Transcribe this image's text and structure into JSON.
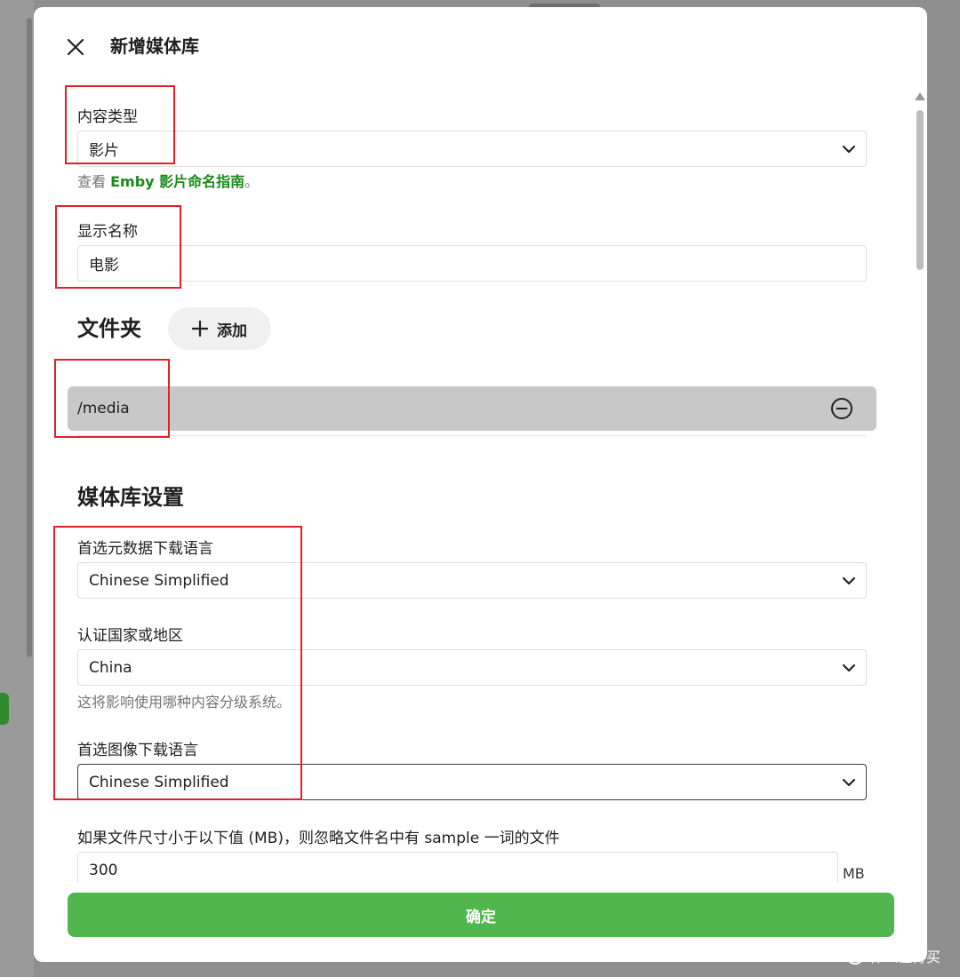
{
  "dialog": {
    "title": "新增媒体库",
    "confirm_label": "确定"
  },
  "content_type": {
    "label": "内容类型",
    "value": "影片",
    "hint_prefix": "查看 ",
    "hint_link": "Emby 影片命名指南",
    "hint_suffix": "。"
  },
  "display_name": {
    "label": "显示名称",
    "value": "电影"
  },
  "folders": {
    "title": "文件夹",
    "add_label": "添加",
    "items": [
      {
        "path": "/media"
      }
    ]
  },
  "library_settings": {
    "title": "媒体库设置",
    "metadata_language": {
      "label": "首选元数据下载语言",
      "value": "Chinese Simplified"
    },
    "country": {
      "label": "认证国家或地区",
      "value": "China",
      "hint": "这将影响使用哪种内容分级系统。"
    },
    "image_language": {
      "label": "首选图像下载语言",
      "value": "Chinese Simplified"
    },
    "sample_size": {
      "label": "如果文件尺寸小于以下值 (MB)，则忽略文件名中有 sample 一词的文件",
      "value": "300",
      "unit": "MB"
    }
  },
  "watermark": {
    "text": "什么值得买",
    "icon": "值"
  },
  "colors": {
    "accent": "#52b64e",
    "link": "#1b8a1b",
    "highlight": "#e0202a"
  }
}
